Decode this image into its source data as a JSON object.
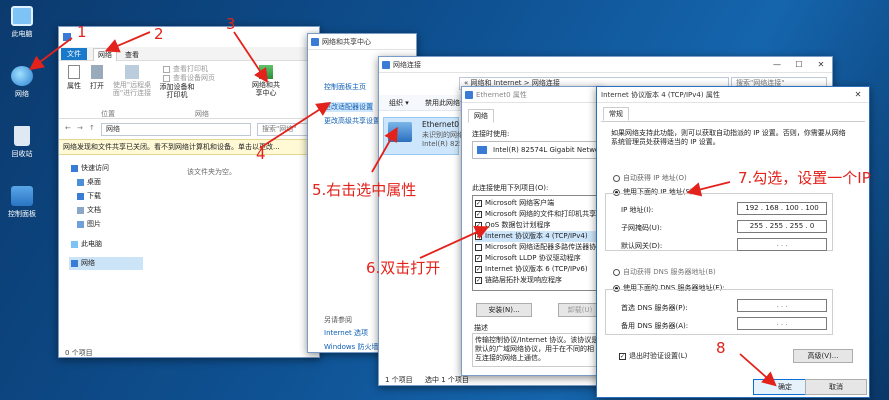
{
  "desktop": {
    "icons": [
      "此电脑",
      "网络",
      "回收站",
      "控制面板"
    ]
  },
  "explorer": {
    "tabs": [
      "文件",
      "网络",
      "查看"
    ],
    "ribbon": {
      "properties": "属性",
      "open": "打开",
      "remote_desktop": "使用\"远程桌面\"进行连接",
      "view_printers": "查看打印机",
      "view_media": "查看设备网页",
      "add_devices": "添加设备和打印机",
      "network_center": "网络和共享中心",
      "group_location": "位置",
      "group_network": "网络"
    },
    "address": "网络",
    "search_placeholder": "搜索\"网络\"",
    "infobar": "网络发现和文件共享已关闭。看不到网络计算机和设备。单击以更改...",
    "empty": "该文件夹为空。",
    "nav": [
      "快速访问",
      "桌面",
      "下载",
      "文档",
      "图片",
      "此电脑",
      "网络"
    ],
    "status": "0 个项目"
  },
  "nsc": {
    "title": "网络和共享中心",
    "links": [
      "控制面板主页",
      "更改适配器设置",
      "更改高级共享设置"
    ],
    "see_also": "另请参阅",
    "see_also_links": [
      "Internet 选项",
      "Windows 防火墙"
    ]
  },
  "netconn": {
    "title": "网络连接",
    "address": "« 网络和 Internet > 网络连接",
    "search_placeholder": "搜索\"网络连接\"",
    "organize": "组织 ▾",
    "disable": "禁用此网络设备",
    "adapter_name": "Ethernet0",
    "adapter_status": "未识别的网络",
    "adapter_driver": "Intel(R) 82574L Gigabit Network C...",
    "status": [
      "1 个项目",
      "选中 1 个项目"
    ]
  },
  "eth_props": {
    "title": "Ethernet0 属性",
    "tab": "网络",
    "connect_using": "连接时使用:",
    "adapter": "Intel(R) 82574L Gigabit Network Connection",
    "items_label": "此连接使用下列项目(O):",
    "items": [
      "Microsoft 网络客户端",
      "Microsoft 网络的文件和打印机共享",
      "QoS 数据包计划程序",
      "Internet 协议版本 4 (TCP/IPv4)",
      "Microsoft 网络适配器多路传送器协议",
      "Microsoft LLDP 协议驱动程序",
      "Internet 协议版本 6 (TCP/IPv6)",
      "链路层拓扑发现响应程序"
    ],
    "install": "安装(N)...",
    "uninstall": "卸载(U)",
    "desc_label": "描述",
    "desc": "传输控制协议/Internet 协议。该协议是默认的广域网络协议，用于在不同的相互连接的网络上通信。"
  },
  "ipv4": {
    "title": "Internet 协议版本 4 (TCP/IPv4) 属性",
    "tab": "常规",
    "intro": "如果网络支持此功能，则可以获取自动指派的 IP 设置。否则，你需要从网络系统管理员处获得适当的 IP 设置。",
    "auto_ip": "自动获得 IP 地址(O)",
    "use_ip": "使用下面的 IP 地址(S):",
    "ip_label": "IP 地址(I):",
    "ip_value": "192 . 168 . 100 . 100",
    "mask_label": "子网掩码(U):",
    "mask_value": "255 . 255 . 255 . 0",
    "gateway_label": "默认网关(D):",
    "gateway_value": ".    .    .",
    "auto_dns": "自动获得 DNS 服务器地址(B)",
    "use_dns": "使用下面的 DNS 服务器地址(E):",
    "dns1_label": "首选 DNS 服务器(P):",
    "dns1_value": ".    .    .",
    "dns2_label": "备用 DNS 服务器(A):",
    "dns2_value": ".    .    .",
    "validate": "退出时验证设置(L)",
    "advanced": "高级(V)...",
    "ok": "确定",
    "cancel": "取消"
  },
  "annotations": {
    "n1": "1",
    "n2": "2",
    "n3": "3",
    "n4": "4",
    "s5": "5.右击选中属性",
    "s6": "6.双击打开",
    "s7": "7.勾选，设置一个IP",
    "n8": "8"
  }
}
